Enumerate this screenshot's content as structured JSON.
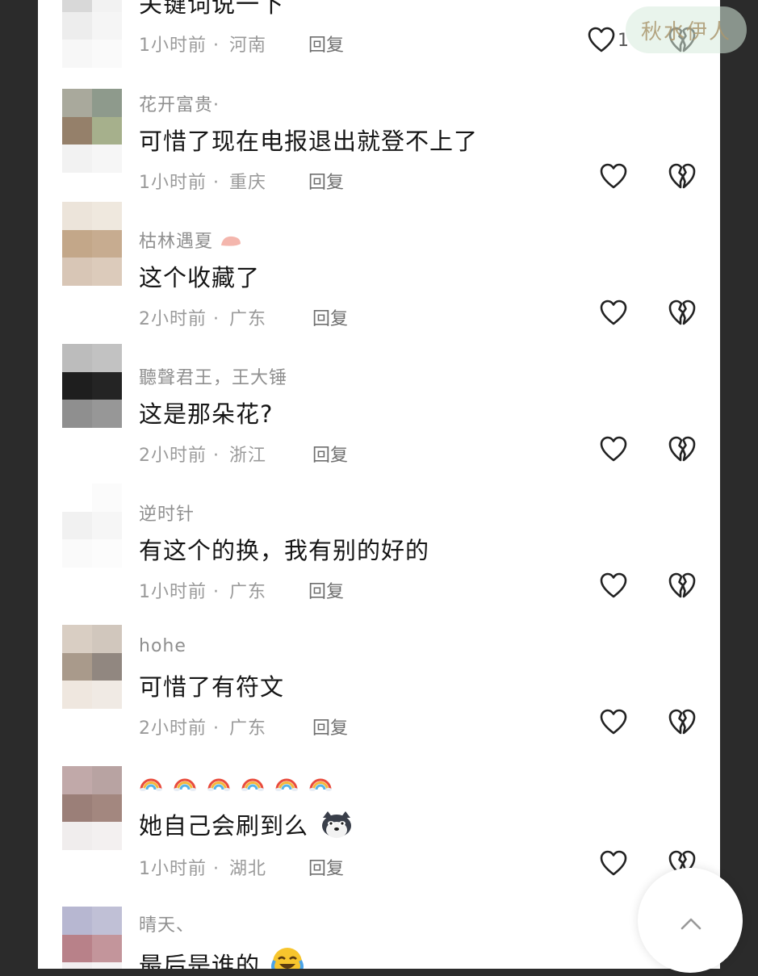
{
  "watermark": "秋水伊人",
  "comments": [
    {
      "name": "",
      "text": "关键词说一下",
      "time": "1小时前",
      "location": "河南",
      "reply": "回复",
      "likes": "1",
      "avatar": [
        "#d8d8d8",
        "#f2f2f2",
        "#ededed",
        "#f5f5f5",
        "#f7f7f7",
        "#fafafa"
      ]
    },
    {
      "name": "花开富贵·",
      "text": "可惜了现在电报退出就登不上了",
      "time": "1小时前",
      "location": "重庆",
      "reply": "回复",
      "likes": "",
      "avatar": [
        "#a9a99c",
        "#8e9a8c",
        "#95806a",
        "#a6b08c",
        "#f2f2f2",
        "#f6f6f6"
      ]
    },
    {
      "name": "枯林遇夏",
      "text": "这个收藏了",
      "time": "2小时前",
      "location": "广东",
      "reply": "回复",
      "likes": "",
      "avatar": [
        "#ece4da",
        "#efe8de",
        "#c3a789",
        "#c7ac90",
        "#d8c6b6",
        "#dccbbb"
      ]
    },
    {
      "name": "聽聲君王，王大锤",
      "text": "这是那朵花?",
      "time": "2小时前",
      "location": "浙江",
      "reply": "回复",
      "likes": "",
      "avatar": [
        "#bcbcbc",
        "#c2c2c2",
        "#1e1e1e",
        "#242424",
        "#8f8f8f",
        "#979797"
      ]
    },
    {
      "name": "逆时针",
      "text": "有这个的换，我有别的好的",
      "time": "1小时前",
      "location": "广东",
      "reply": "回复",
      "likes": "",
      "avatar": [
        "#ffffff",
        "#fbfbfb",
        "#f1f1f1",
        "#f6f6f6",
        "#fafafa",
        "#fcfcfc"
      ]
    },
    {
      "name": "hohe",
      "text": "可惜了有符文",
      "time": "2小时前",
      "location": "广东",
      "reply": "回复",
      "likes": "",
      "avatar": [
        "#d9cec3",
        "#d1c7bd",
        "#a99a8b",
        "#918780",
        "#efe7df",
        "#f0eae4"
      ]
    },
    {
      "name": "",
      "text": "她自己会刷到么",
      "time": "1小时前",
      "location": "湖北",
      "reply": "回复",
      "likes": "",
      "avatar": [
        "#c1a9a9",
        "#b8a3a2",
        "#9b7f78",
        "#a3877f",
        "#f0eded",
        "#f3f0f0"
      ]
    },
    {
      "name": "晴天、",
      "text": "最后是谁的",
      "time": "",
      "location": "",
      "reply": "",
      "likes": "",
      "avatar": [
        "#b7b7d1",
        "#c0c0d6",
        "#b88189",
        "#c3959b",
        "#f1eef0",
        "#f5f3f4"
      ]
    }
  ]
}
